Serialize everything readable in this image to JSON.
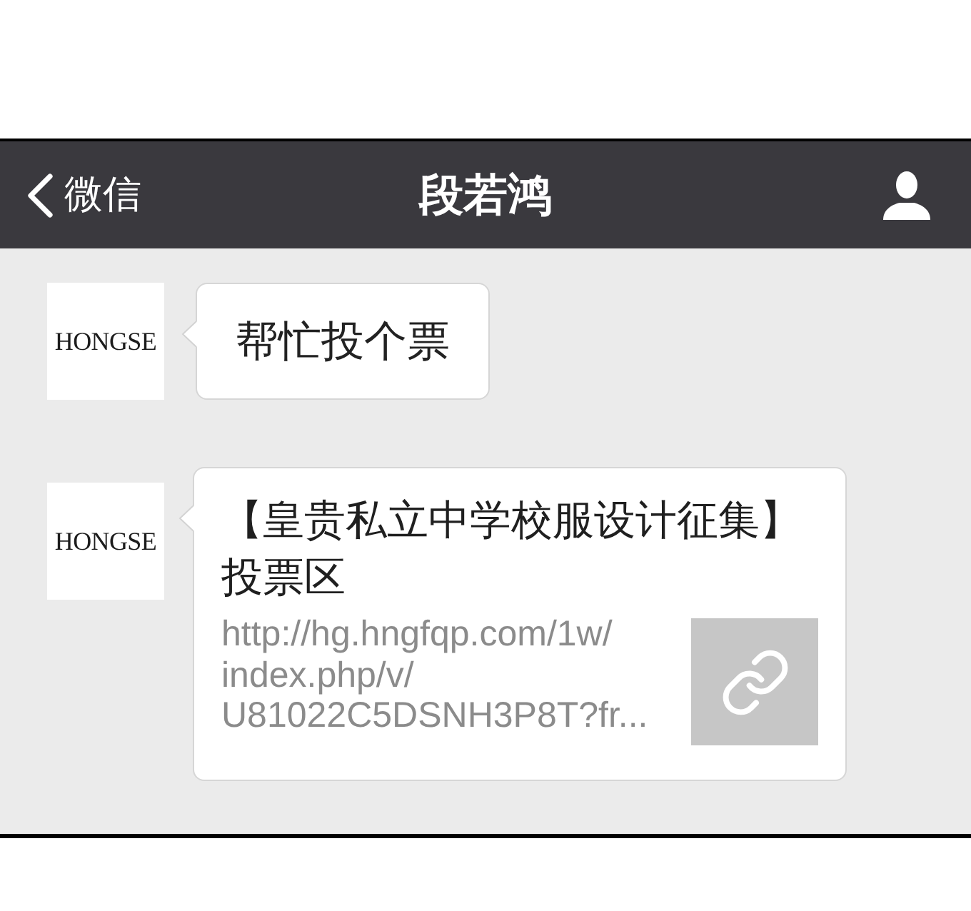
{
  "nav_bar": {
    "back_label": "微信",
    "title": "段若鸿"
  },
  "messages": [
    {
      "kind": "text",
      "avatar": "HONGSE",
      "text": "帮忙投个票"
    },
    {
      "kind": "link",
      "avatar": "HONGSE",
      "title": "【皇贵私立中学校服设计征集】投票区",
      "description": "http://hg.hngfqp.com/1w/index.php/v/U81022C5DSNH3P8T?fr..."
    }
  ]
}
